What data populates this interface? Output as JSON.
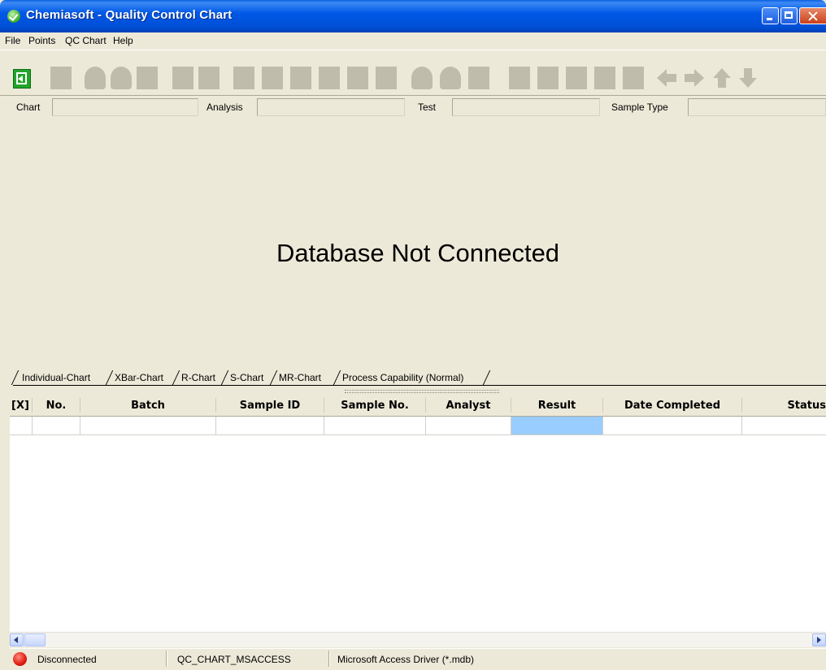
{
  "window": {
    "title": "Chemiasoft - Quality Control Chart"
  },
  "menu": [
    "File",
    "Points",
    "QC Chart",
    "Help"
  ],
  "filters": {
    "chart_label": "Chart",
    "analysis_label": "Analysis",
    "test_label": "Test",
    "sample_type_label": "Sample Type"
  },
  "chart": {
    "message": "Database Not Connected"
  },
  "tabs": [
    "Individual-Chart",
    "XBar-Chart",
    "R-Chart",
    "S-Chart",
    "MR-Chart",
    "Process Capability (Normal)"
  ],
  "grid": {
    "columns": [
      "[X]",
      "No.",
      "Batch",
      "Sample ID",
      "Sample No.",
      "Analyst",
      "Result",
      "Date Completed",
      "Status"
    ],
    "selected_cell_color": "#99ccff"
  },
  "status": {
    "connection": "Disconnected",
    "dsn": "QC_CHART_MSACCESS",
    "driver": "Microsoft Access Driver (*.mdb)",
    "indicator_color": "#e01a10"
  },
  "icons": [
    "exit-icon",
    "left-arrow-icon",
    "right-arrow-icon",
    "up-arrow-icon",
    "down-arrow-icon"
  ]
}
